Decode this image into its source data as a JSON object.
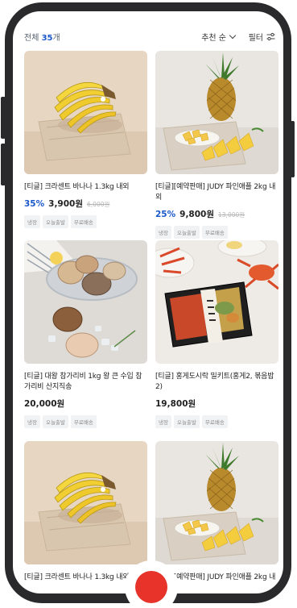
{
  "header": {
    "total_prefix": "전체",
    "total_count": "35",
    "total_suffix": "개",
    "sort_label": "추천 순",
    "filter_label": "필터"
  },
  "products": [
    {
      "title": "[티글] 크라센트 바나나 1.3kg 내외",
      "discount": "35%",
      "price": "3,900원",
      "original_price": "6,000원",
      "tags": [
        "냉장",
        "오늘출발",
        "무료배송"
      ],
      "image": "banana"
    },
    {
      "title": "[티글][예약판매] JUDY 파인애플 2kg 내외",
      "discount": "25%",
      "price": "9,800원",
      "original_price": "13,000원",
      "tags": [
        "냉장",
        "오늘출발",
        "무료배송"
      ],
      "image": "pineapple"
    },
    {
      "title": "[티글] 대왕 참가리비 1kg 왕 큰 수입 참가리비 산지직송",
      "discount": "",
      "price": "20,000원",
      "original_price": "",
      "tags": [
        "냉장",
        "오늘출발",
        "무료배송"
      ],
      "image": "scallop"
    },
    {
      "title": "[티글] 홍게도시락 밀키트(홍게2, 볶음밥2)",
      "discount": "",
      "price": "19,800원",
      "original_price": "",
      "tags": [
        "냉장",
        "오늘출발",
        "무료배송"
      ],
      "image": "crab"
    },
    {
      "title": "[티글] 크라센트 바나나 1.3kg 내외",
      "discount": "",
      "price": "",
      "original_price": "",
      "tags": [],
      "image": "banana"
    },
    {
      "title": "[티글][예약판매] JUDY 파인애플 2kg 내외",
      "discount": "",
      "price": "",
      "original_price": "",
      "tags": [],
      "image": "pineapple"
    }
  ],
  "colors": {
    "accent": "#1a58c9",
    "home_button": "#e8332b",
    "phone_frame": "#2a2a2c"
  },
  "icons": {
    "sort": "chevron-down-icon",
    "filter": "filter-sliders-icon",
    "home": "home-button"
  }
}
